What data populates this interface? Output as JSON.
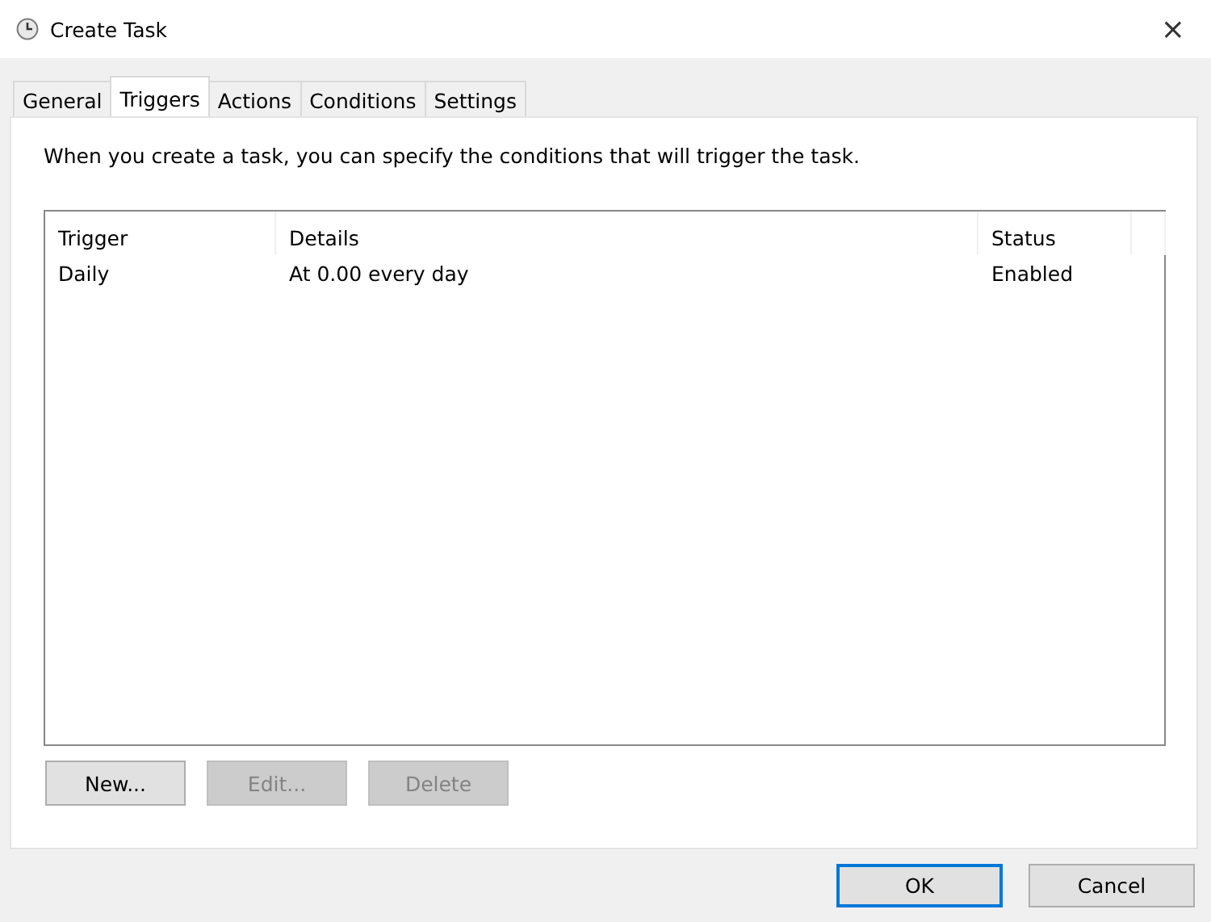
{
  "window": {
    "title": "Create Task",
    "close": "×"
  },
  "tabs": [
    {
      "label": "General",
      "selected": false
    },
    {
      "label": "Triggers",
      "selected": true
    },
    {
      "label": "Actions",
      "selected": false
    },
    {
      "label": "Conditions",
      "selected": false
    },
    {
      "label": "Settings",
      "selected": false
    }
  ],
  "description": "When you create a task, you can specify the conditions that will trigger the task.",
  "table": {
    "columns": [
      "Trigger",
      "Details",
      "Status"
    ],
    "rows": [
      {
        "cells": [
          "Daily",
          "At 0.00 every day",
          "Enabled"
        ],
        "selected": false
      }
    ]
  },
  "list_buttons": [
    {
      "label": "New...",
      "disabled": false
    },
    {
      "label": "Edit...",
      "disabled": true
    },
    {
      "label": "Delete",
      "disabled": true
    }
  ],
  "dialog_buttons": [
    {
      "label": "OK",
      "default": true
    },
    {
      "label": "Cancel",
      "default": false
    }
  ]
}
